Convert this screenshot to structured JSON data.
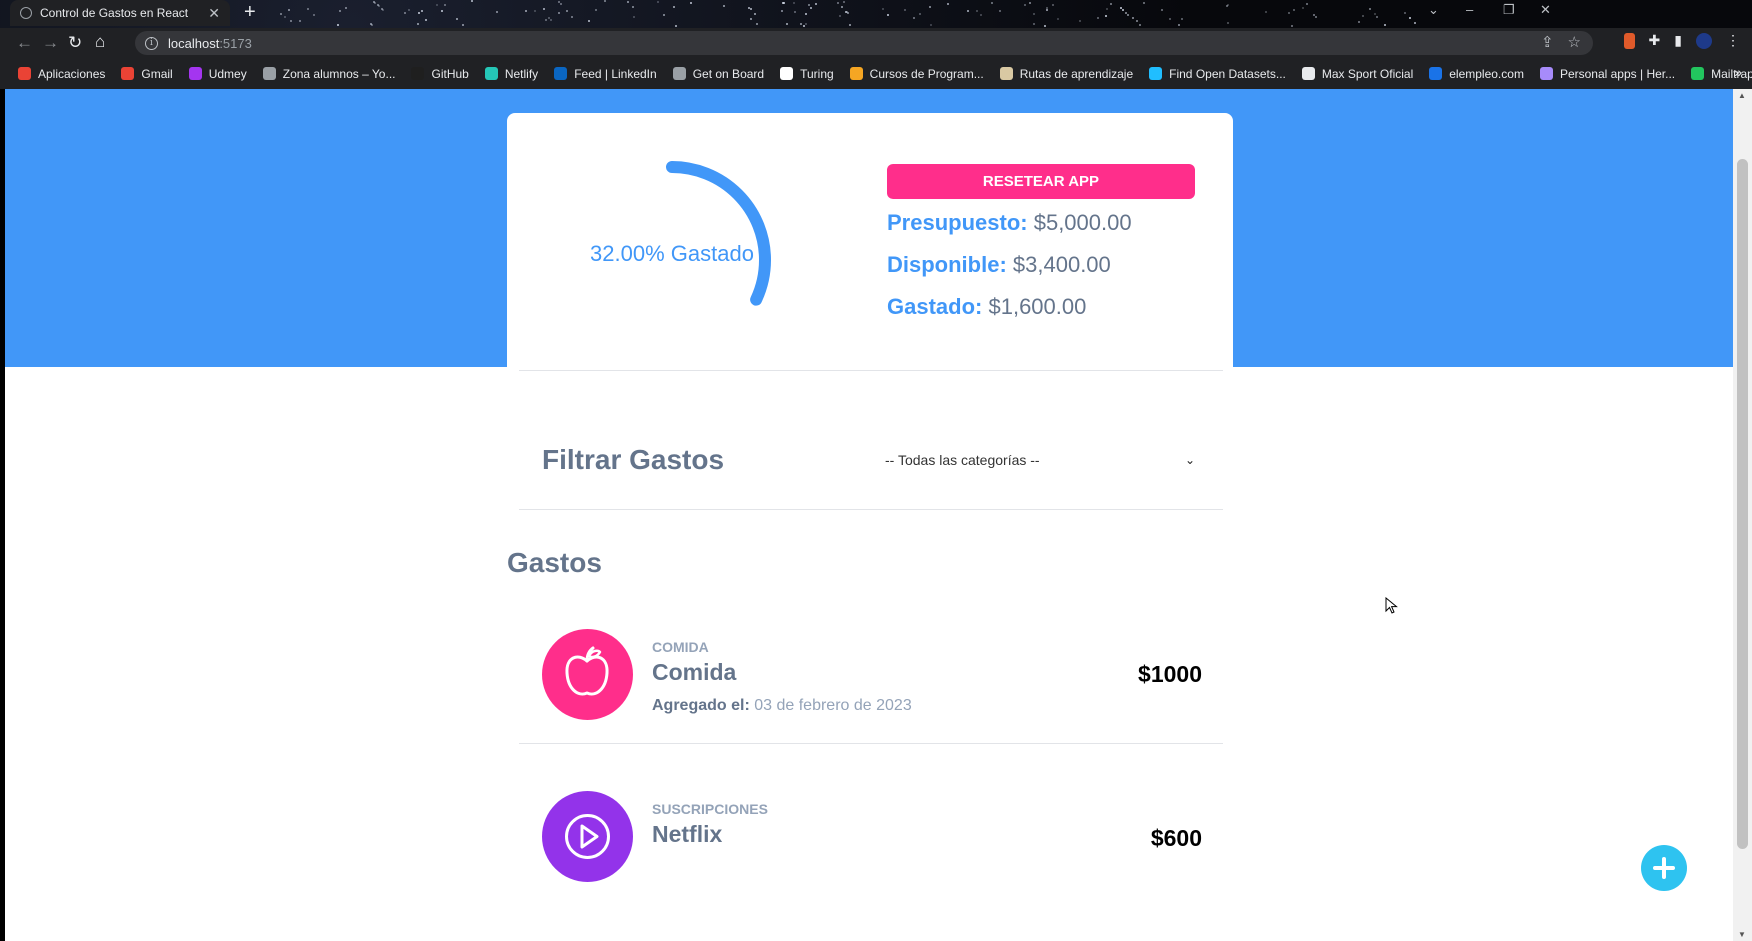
{
  "browser": {
    "tab_title": "Control de Gastos en React",
    "new_tab": "+",
    "url_host": "localhost",
    "url_port": ":5173",
    "bookmarks": [
      {
        "label": "Aplicaciones",
        "color": "#ea4335"
      },
      {
        "label": "Gmail",
        "color": "#ea4335"
      },
      {
        "label": "Udmey",
        "color": "#a435f0"
      },
      {
        "label": "Zona alumnos – Yo...",
        "color": "#9aa0a6"
      },
      {
        "label": "GitHub",
        "color": "#1f1f1f"
      },
      {
        "label": "Netlify",
        "color": "#25c7b7"
      },
      {
        "label": "Feed | LinkedIn",
        "color": "#0a66c2"
      },
      {
        "label": "Get on Board",
        "color": "#9aa0a6"
      },
      {
        "label": "Turing",
        "color": "#ffffff"
      },
      {
        "label": "Cursos de Program...",
        "color": "#f5a623"
      },
      {
        "label": "Rutas de aprendizaje",
        "color": "#d9c9a3"
      },
      {
        "label": "Find Open Datasets...",
        "color": "#20beff"
      },
      {
        "label": "Max Sport Oficial",
        "color": "#e8eaed"
      },
      {
        "label": "elempleo.com",
        "color": "#1a73e8"
      },
      {
        "label": "Personal apps | Her...",
        "color": "#a78bfa"
      },
      {
        "label": "Mailtrap",
        "color": "#22c55e"
      }
    ],
    "bookmarks_more": "»"
  },
  "app": {
    "accent": "#4197f8",
    "pink": "#ff2e8b",
    "presupuesto": {
      "gauge_label": "32.00% Gastado",
      "percent_spent": 32,
      "reset_button": "Resetear App",
      "budget_label": "Presupuesto:",
      "budget_value": "$5,000.00",
      "available_label": "Disponible:",
      "available_value": "$3,400.00",
      "spent_label": "Gastado:",
      "spent_value": "$1,600.00"
    },
    "filtro": {
      "title": "Filtrar Gastos",
      "selected": "-- Todas las categorías --"
    },
    "gastos": {
      "title": "Gastos",
      "items": [
        {
          "category": "Comida",
          "name": "Comida",
          "date_label": "Agregado el:",
          "date": "03 de febrero de 2023",
          "amount": "$1000",
          "icon": "apple-icon",
          "color": "#ff2e8b"
        },
        {
          "category": "Suscripciones",
          "name": "Netflix",
          "amount": "$600",
          "icon": "play-icon",
          "color": "#9333ea"
        }
      ]
    },
    "fab_icon": "plus-icon"
  }
}
